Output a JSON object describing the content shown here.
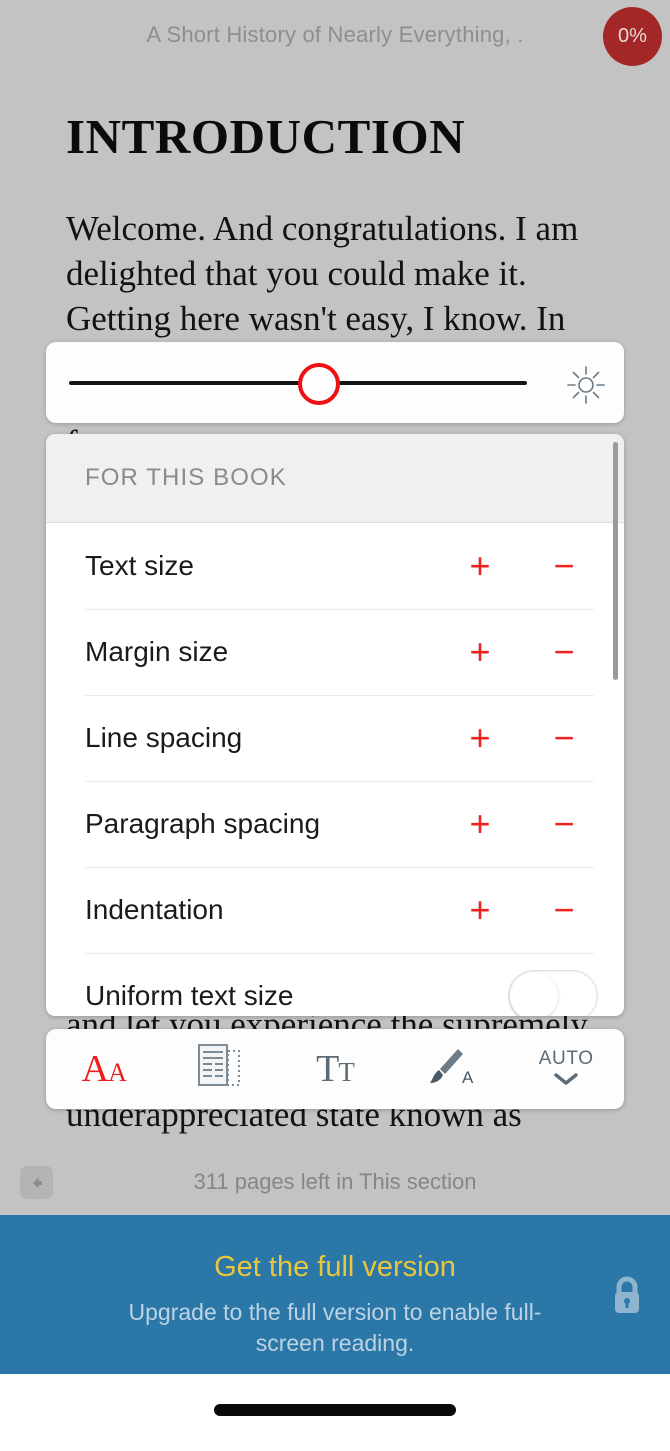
{
  "reader": {
    "book_title": "A Short History of Nearly Everything, .",
    "progress_badge": "0%",
    "chapter_title": "INTRODUCTION",
    "paragraph_1": "Welcome. And congratulations. I am delighted that you could make it. Getting here wasn't easy, I know. In",
    "paragraph_2": "fact,",
    "paragraph_3": "and let you experience the supremely",
    "paragraph_4": "underappreciated state known as",
    "pages_left": "311 pages left in This section",
    "back_icon": "arrow-left-icon"
  },
  "brightness": {
    "slider_value": 50,
    "sun_icon": "brightness-sun-icon"
  },
  "settings": {
    "header": "FOR THIS BOOK",
    "rows": [
      {
        "label": "Text size",
        "control": "stepper",
        "plus": "+",
        "minus": "−"
      },
      {
        "label": "Margin size",
        "control": "stepper",
        "plus": "+",
        "minus": "−"
      },
      {
        "label": "Line spacing",
        "control": "stepper",
        "plus": "+",
        "minus": "−"
      },
      {
        "label": "Paragraph spacing",
        "control": "stepper",
        "plus": "+",
        "minus": "−"
      },
      {
        "label": "Indentation",
        "control": "stepper",
        "plus": "+",
        "minus": "−"
      },
      {
        "label": "Uniform text size",
        "control": "toggle",
        "value": "off"
      }
    ]
  },
  "toolbar": {
    "items": [
      {
        "name": "text-size-tool",
        "icon": "aa-icon",
        "primary": "A",
        "secondary": "A",
        "active": true
      },
      {
        "name": "layout-tool",
        "icon": "page-layout-icon",
        "primary": "",
        "secondary": "",
        "active": false
      },
      {
        "name": "font-tool",
        "icon": "tt-icon",
        "primary": "T",
        "secondary": "T",
        "active": false
      },
      {
        "name": "theme-tool",
        "icon": "brush-a-icon",
        "primary": "",
        "secondary": "",
        "active": false
      },
      {
        "name": "auto-tool",
        "icon": "chevron-down-icon",
        "primary": "AUTO",
        "secondary": "",
        "active": false
      }
    ]
  },
  "banner": {
    "title": "Get the full version",
    "subtitle": "Upgrade to the full version to enable full-screen reading.",
    "lock_icon": "lock-icon"
  },
  "colors": {
    "accent_red": "#ee1d1d",
    "badge_red": "#a32727",
    "banner_blue": "#2a77a8",
    "banner_yellow": "#e9c63c",
    "page_dim": "#c3c3c3",
    "icon_gray": "#5d6b76"
  }
}
